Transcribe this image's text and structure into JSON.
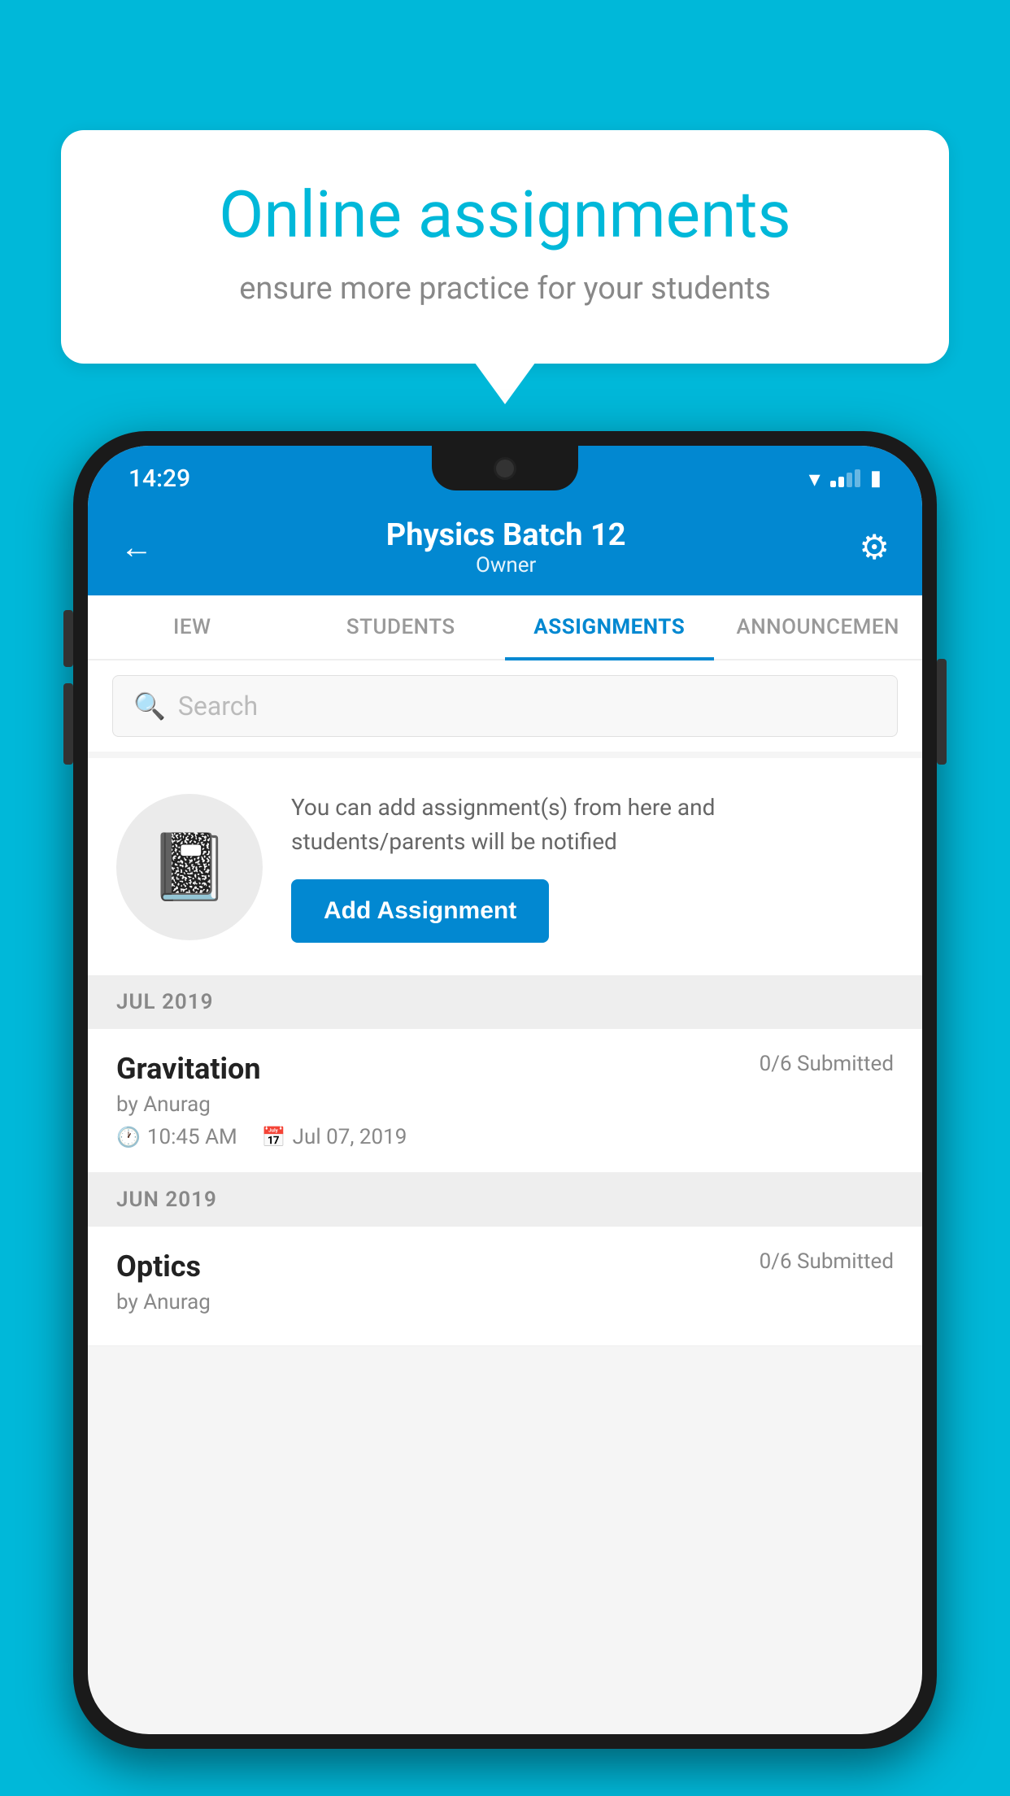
{
  "background_color": "#00b8d9",
  "speech_bubble": {
    "title": "Online assignments",
    "subtitle": "ensure more practice for your students"
  },
  "phone": {
    "status_bar": {
      "time": "14:29"
    },
    "header": {
      "title": "Physics Batch 12",
      "subtitle": "Owner",
      "back_label": "←",
      "settings_label": "⚙"
    },
    "tabs": [
      {
        "label": "IEW",
        "active": false
      },
      {
        "label": "STUDENTS",
        "active": false
      },
      {
        "label": "ASSIGNMENTS",
        "active": true
      },
      {
        "label": "ANNOUNCEMENTS",
        "active": false
      }
    ],
    "search": {
      "placeholder": "Search"
    },
    "add_assignment": {
      "description": "You can add assignment(s) from here and students/parents will be notified",
      "button_label": "Add Assignment"
    },
    "sections": [
      {
        "month_label": "JUL 2019",
        "assignments": [
          {
            "name": "Gravitation",
            "submitted": "0/6 Submitted",
            "author": "by Anurag",
            "time": "10:45 AM",
            "date": "Jul 07, 2019"
          }
        ]
      },
      {
        "month_label": "JUN 2019",
        "assignments": [
          {
            "name": "Optics",
            "submitted": "0/6 Submitted",
            "author": "by Anurag",
            "time": "",
            "date": ""
          }
        ]
      }
    ]
  }
}
